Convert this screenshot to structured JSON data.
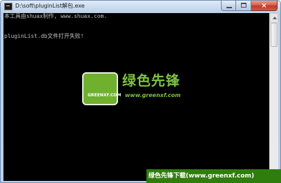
{
  "window": {
    "title": "D:\\soft\\pluginList解包.exe",
    "icon": "console-app-icon",
    "close_glyph": "×"
  },
  "console": {
    "lines": [
      "本工具由shuax制作, www.shuax.com.",
      "pluginList.db文件打开失败!"
    ]
  },
  "watermark": {
    "logo_text": "GREENXF.COM",
    "name": "绿色先锋",
    "url": "www.greenxf.com"
  },
  "banner": {
    "text": "绿色先锋下载(www.greenxf.com)"
  },
  "colors": {
    "console_bg": "#000000",
    "console_text": "#c0c0c0",
    "watermark_green": "#7cc242",
    "banner_bg": "#2f7d0c"
  }
}
